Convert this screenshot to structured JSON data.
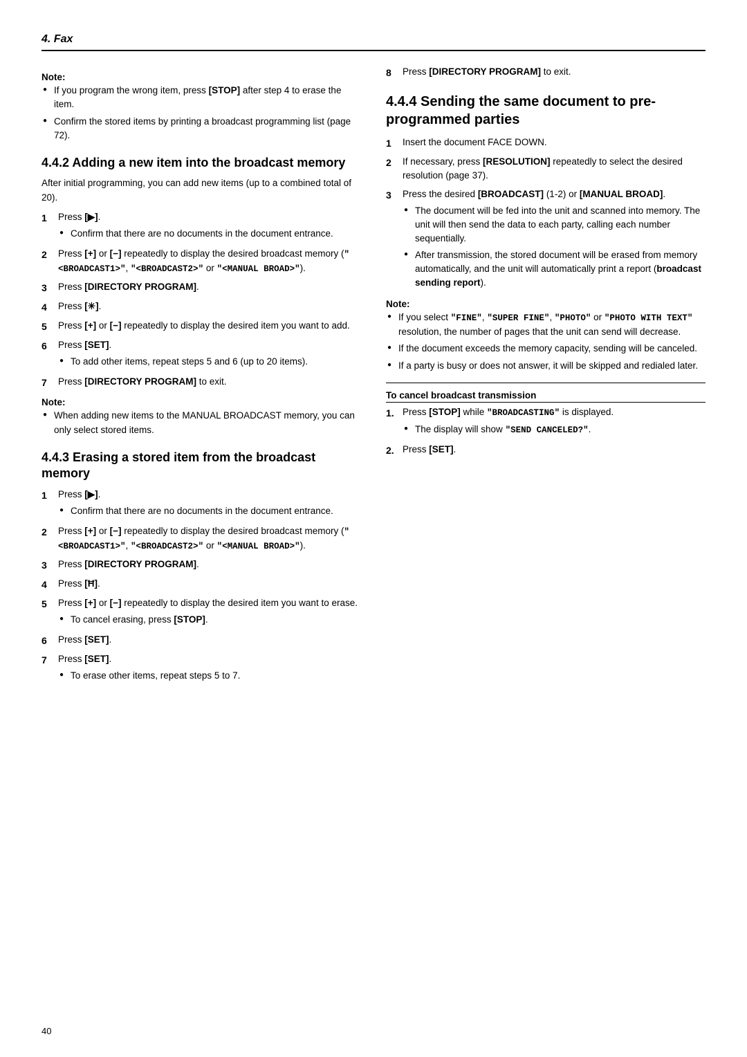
{
  "header": {
    "title": "4. Fax"
  },
  "footer": {
    "page_number": "40"
  },
  "left_column": {
    "note_top": {
      "label": "Note:",
      "items": [
        "If you program the wrong item, press [STOP] after step 4 to erase the item.",
        "Confirm the stored items by printing a broadcast programming list (page 72)."
      ]
    },
    "section_422": {
      "title": "4.4.2 Adding a new item into the broadcast memory",
      "intro": "After initial programming, you can add new items (up to a combined total of 20).",
      "steps": [
        {
          "num": "1",
          "text": "Press [▶].",
          "bullets": [
            "Confirm that there are no documents in the document entrance."
          ]
        },
        {
          "num": "2",
          "text": "Press [+] or [−] repeatedly to display the desired broadcast memory (\"<BROADCAST1>\", \"<BROADCAST2>\" or \"<MANUAL BROAD>\").",
          "bullets": []
        },
        {
          "num": "3",
          "text": "Press [DIRECTORY PROGRAM].",
          "bullets": []
        },
        {
          "num": "4",
          "text": "Press [✳].",
          "bullets": []
        },
        {
          "num": "5",
          "text": "Press [+] or [−] repeatedly to display the desired item you want to add.",
          "bullets": []
        },
        {
          "num": "6",
          "text": "Press [SET].",
          "bullets": [
            "To add other items, repeat steps 5 and 6 (up to 20 items)."
          ]
        },
        {
          "num": "7",
          "text": "Press [DIRECTORY PROGRAM] to exit.",
          "bullets": []
        }
      ],
      "note_bottom": {
        "label": "Note:",
        "items": [
          "When adding new items to the MANUAL BROADCAST memory, you can only select stored items."
        ]
      }
    },
    "section_423": {
      "title": "4.4.3 Erasing a stored item from the broadcast memory",
      "steps": [
        {
          "num": "1",
          "text": "Press [▶].",
          "bullets": [
            "Confirm that there are no documents in the document entrance."
          ]
        },
        {
          "num": "2",
          "text": "Press [+] or [−] repeatedly to display the desired broadcast memory (\"<BROADCAST1>\", \"<BROADCAST2>\" or \"<MANUAL BROAD>\").",
          "bullets": []
        },
        {
          "num": "3",
          "text": "Press [DIRECTORY PROGRAM].",
          "bullets": []
        },
        {
          "num": "4",
          "text": "Press [Ħ].",
          "bullets": []
        },
        {
          "num": "5",
          "text": "Press [+] or [−] repeatedly to display the desired item you want to erase.",
          "bullets": [
            "To cancel erasing, press [STOP]."
          ]
        },
        {
          "num": "6",
          "text": "Press [SET].",
          "bullets": []
        },
        {
          "num": "7",
          "text": "Press [SET].",
          "bullets": [
            "To erase other items, repeat steps 5 to 7."
          ]
        }
      ]
    }
  },
  "right_column": {
    "step_8": {
      "num": "8",
      "text": "Press [DIRECTORY PROGRAM] to exit."
    },
    "section_444": {
      "title": "4.4.4 Sending the same document to pre-programmed parties",
      "steps": [
        {
          "num": "1",
          "text": "Insert the document FACE DOWN.",
          "bullets": []
        },
        {
          "num": "2",
          "text": "If necessary, press [RESOLUTION] repeatedly to select the desired resolution (page 37).",
          "bullets": []
        },
        {
          "num": "3",
          "text": "Press the desired [BROADCAST] (1-2) or [MANUAL BROAD].",
          "bullets": [
            "The document will be fed into the unit and scanned into memory. The unit will then send the data to each party, calling each number sequentially.",
            "After transmission, the stored document will be erased from memory automatically, and the unit will automatically print a report (broadcast sending report)."
          ]
        }
      ],
      "note": {
        "label": "Note:",
        "items": [
          "If you select \"FINE\", \"SUPER FINE\", \"PHOTO\" or \"PHOTO WITH TEXT\" resolution, the number of pages that the unit can send will decrease.",
          "If the document exceeds the memory capacity, sending will be canceled.",
          "If a party is busy or does not answer, it will be skipped and redialed later."
        ]
      },
      "to_cancel": {
        "label": "To cancel broadcast transmission",
        "steps": [
          {
            "num": "1.",
            "text": "Press [STOP] while \"BROADCASTING\" is displayed.",
            "bullets": [
              "The display will show \"SEND CANCELED?\"."
            ]
          },
          {
            "num": "2.",
            "text": "Press [SET].",
            "bullets": []
          }
        ]
      }
    }
  }
}
